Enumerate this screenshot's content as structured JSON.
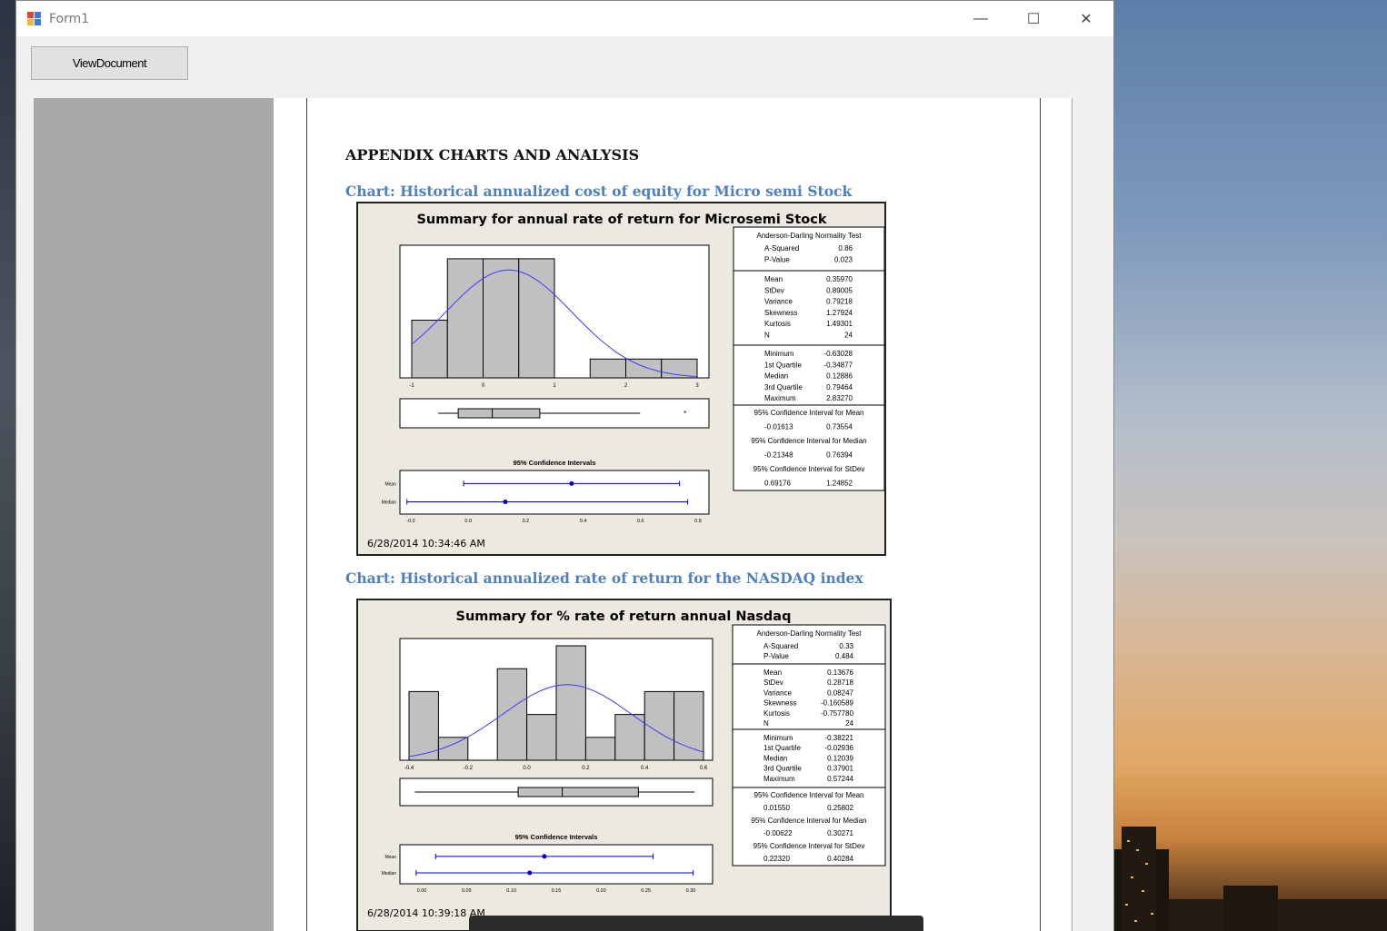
{
  "window": {
    "title": "Form1",
    "minimize_glyph": "—",
    "maximize_glyph": "☐",
    "close_glyph": "✕"
  },
  "toolbar": {
    "view_document_label": "ViewDocument"
  },
  "document": {
    "heading": "APPENDIX CHARTS AND ANALYSIS",
    "charts": [
      {
        "caption": "Chart: Historical annualized cost of equity for Micro semi Stock",
        "title": "Summary for annual rate of return for Microsemi Stock",
        "timestamp": "6/28/2014 10:34:46 AM",
        "ci_title": "95% Confidence Intervals",
        "hist_ticks": [
          "-1",
          "0",
          "1",
          "2",
          "3"
        ],
        "ci_ticks": [
          "-0.2",
          "0.0",
          "0.2",
          "0.4",
          "0.6",
          "0.8"
        ],
        "ci_row_labels": [
          "Mean",
          "Median"
        ],
        "ad_test_title": "Anderson-Darling Normality Test",
        "stats": [
          [
            "A-Squared",
            "0.86"
          ],
          [
            "P-Value",
            "0.023"
          ]
        ],
        "desc": [
          [
            "Mean",
            "0.35970"
          ],
          [
            "StDev",
            "0.89005"
          ],
          [
            "Variance",
            "0.79218"
          ],
          [
            "Skewness",
            "1.27924"
          ],
          [
            "Kurtosis",
            "1.49301"
          ],
          [
            "N",
            "24"
          ]
        ],
        "quartiles": [
          [
            "Minimum",
            "-0.63028"
          ],
          [
            "1st Quartile",
            "-0.34877"
          ],
          [
            "Median",
            "0.12886"
          ],
          [
            "3rd Quartile",
            "0.79464"
          ],
          [
            "Maximum",
            "2.83270"
          ]
        ],
        "ci_mean_label": "95% Confidence Interval for Mean",
        "ci_mean": [
          "-0.01613",
          "0.73554"
        ],
        "ci_median_label": "95% Confidence Interval for Median",
        "ci_median": [
          "-0.21348",
          "0.76394"
        ],
        "ci_stdev_label": "95% Confidence Interval for StDev",
        "ci_stdev": [
          "0.69176",
          "1.24852"
        ]
      },
      {
        "caption": "Chart: Historical annualized rate of return for the NASDAQ index",
        "title": "Summary for % rate of return annual Nasdaq",
        "timestamp": "6/28/2014 10:39:18 AM",
        "ci_title": "95% Confidence Intervals",
        "hist_ticks": [
          "-0.4",
          "-0.2",
          "0.0",
          "0.2",
          "0.4",
          "0.6"
        ],
        "ci_ticks": [
          "0.00",
          "0.05",
          "0.10",
          "0.15",
          "0.20",
          "0.25",
          "0.30"
        ],
        "ci_row_labels": [
          "Mean",
          "Median"
        ],
        "ad_test_title": "Anderson-Darling Normality Test",
        "stats": [
          [
            "A-Squared",
            "0.33"
          ],
          [
            "P-Value",
            "0.484"
          ]
        ],
        "desc": [
          [
            "Mean",
            "0.13676"
          ],
          [
            "StDev",
            "0.28718"
          ],
          [
            "Variance",
            "0.08247"
          ],
          [
            "Skewness",
            "-0.160589"
          ],
          [
            "Kurtosis",
            "-0.757780"
          ],
          [
            "N",
            "24"
          ]
        ],
        "quartiles": [
          [
            "Minimum",
            "-0.38221"
          ],
          [
            "1st Quartile",
            "-0.02936"
          ],
          [
            "Median",
            "0.12039"
          ],
          [
            "3rd Quartile",
            "0.37901"
          ],
          [
            "Maximum",
            "0.57244"
          ]
        ],
        "ci_mean_label": "95% Confidence Interval for Mean",
        "ci_mean": [
          "0.01550",
          "0.25802"
        ],
        "ci_median_label": "95% Confidence Interval for Median",
        "ci_median": [
          "-0.00622",
          "0.30271"
        ],
        "ci_stdev_label": "95% Confidence Interval for StDev",
        "ci_stdev": [
          "0.22320",
          "0.40284"
        ]
      }
    ]
  },
  "colors": {
    "caption_blue": "#4f81bd",
    "curve_blue": "#3b3bff",
    "bar_gray": "#c0c0c0",
    "frame_bg": "#ece9e1"
  }
}
